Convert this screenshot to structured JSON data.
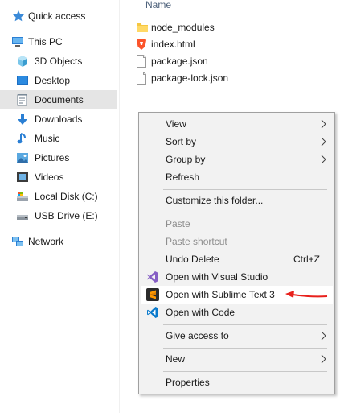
{
  "nav": {
    "items": [
      {
        "label": "Quick access",
        "icon": "star-icon"
      },
      {
        "label": "This PC",
        "icon": "computer-icon"
      },
      {
        "label": "3D Objects",
        "icon": "3d-objects-icon"
      },
      {
        "label": "Desktop",
        "icon": "desktop-icon"
      },
      {
        "label": "Documents",
        "icon": "documents-icon"
      },
      {
        "label": "Downloads",
        "icon": "downloads-icon"
      },
      {
        "label": "Music",
        "icon": "music-icon"
      },
      {
        "label": "Pictures",
        "icon": "pictures-icon"
      },
      {
        "label": "Videos",
        "icon": "videos-icon"
      },
      {
        "label": "Local Disk (C:)",
        "icon": "local-disk-icon"
      },
      {
        "label": "USB Drive (E:)",
        "icon": "usb-drive-icon"
      },
      {
        "label": "Network",
        "icon": "network-icon"
      }
    ]
  },
  "content": {
    "column_header": "Name",
    "files": [
      {
        "label": "node_modules",
        "icon": "folder-icon"
      },
      {
        "label": "index.html",
        "icon": "brave-html-icon"
      },
      {
        "label": "package.json",
        "icon": "json-file-icon"
      },
      {
        "label": "package-lock.json",
        "icon": "json-file-icon"
      }
    ]
  },
  "menu": {
    "view": "View",
    "sort_by": "Sort by",
    "group_by": "Group by",
    "refresh": "Refresh",
    "customize": "Customize this folder...",
    "paste": "Paste",
    "paste_shortcut": "Paste shortcut",
    "undo_delete": "Undo Delete",
    "undo_delete_shortcut": "Ctrl+Z",
    "open_vs": "Open with Visual Studio",
    "open_sublime": "Open with Sublime Text 3",
    "open_code": "Open with Code",
    "give_access": "Give access to",
    "new": "New",
    "properties": "Properties"
  },
  "colors": {
    "selection": "#e5e5e5",
    "menu_background": "#f2f2f2",
    "menu_hover": "#ffffff",
    "annotation_arrow": "#e8211c",
    "disabled_text": "#8d8d8d"
  }
}
